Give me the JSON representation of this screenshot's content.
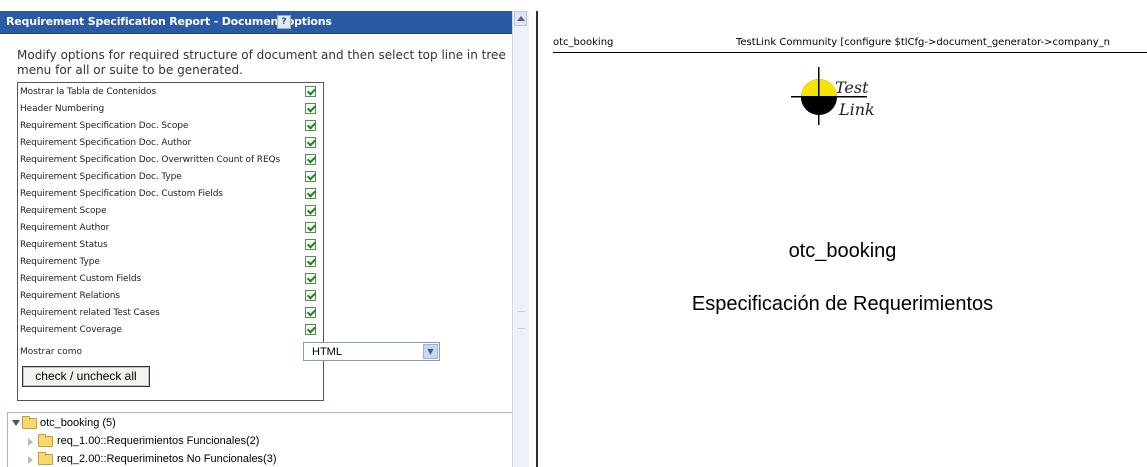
{
  "panel": {
    "title": "Requirement Specification Report - Document options",
    "help_icon": "?",
    "instructions": "Modify options for required structure of document and then select top line in tree menu for all or suite to be generated."
  },
  "options": [
    {
      "label": "Mostrar la Tabla de Contenidos",
      "checked": true
    },
    {
      "label": "Header Numbering",
      "checked": true
    },
    {
      "label": "Requirement Specification Doc. Scope",
      "checked": true
    },
    {
      "label": "Requirement Specification Doc. Author",
      "checked": true
    },
    {
      "label": "Requirement Specification Doc. Overwritten Count of REQs",
      "checked": true
    },
    {
      "label": "Requirement Specification Doc. Type",
      "checked": true
    },
    {
      "label": "Requirement Specification Doc. Custom Fields",
      "checked": true
    },
    {
      "label": "Requirement Scope",
      "checked": true
    },
    {
      "label": "Requirement Author",
      "checked": true
    },
    {
      "label": "Requirement Status",
      "checked": true
    },
    {
      "label": "Requirement Type",
      "checked": true
    },
    {
      "label": "Requirement Custom Fields",
      "checked": true
    },
    {
      "label": "Requirement Relations",
      "checked": true
    },
    {
      "label": "Requirement related Test Cases",
      "checked": true
    },
    {
      "label": "Requirement Coverage",
      "checked": true
    }
  ],
  "format": {
    "label": "Mostrar como",
    "value": "HTML"
  },
  "check_all_label": "check / uncheck all",
  "tree": {
    "root": "otc_booking (5)",
    "children": [
      "req_1.00::Requerimientos Funcionales(2)",
      "req_2.00::Requeriminetos No Funcionales(3)"
    ]
  },
  "document": {
    "header_left": "otc_booking",
    "header_right": "TestLink Community [configure $tlCfg->document_generator->company_n",
    "logo_text_1": "Test",
    "logo_text_2": "Link",
    "title": "otc_booking",
    "subtitle": "Especificación de Requerimientos"
  },
  "colors": {
    "header_bg": "#2b5aa4",
    "check_green": "#2a7a2a",
    "folder_yellow": "#f6d96e",
    "logo_yellow": "#f5e400"
  }
}
